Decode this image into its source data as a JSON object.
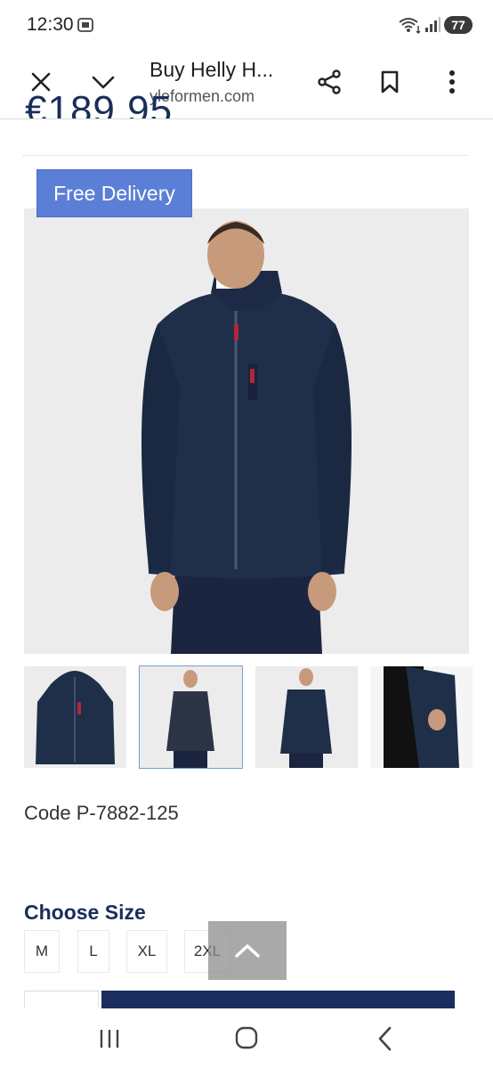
{
  "status_bar": {
    "time": "12:30",
    "battery": "77"
  },
  "browser": {
    "title": "Buy Helly H...",
    "url": "yleformen.com"
  },
  "product": {
    "price": "€189.95",
    "badge": "Free Delivery",
    "code": "Code P-7882-125",
    "colors": {
      "jacket": "#1f2e49",
      "accent": "#1a2d5c",
      "badge": "#5b7fd6"
    }
  },
  "sizes": {
    "heading": "Choose Size",
    "options": [
      "M",
      "L",
      "XL",
      "2XL"
    ]
  },
  "icons": {
    "close": "close-icon",
    "collapse": "chevron-down-icon",
    "share": "share-icon",
    "bookmark": "bookmark-icon",
    "menu": "more-vertical-icon",
    "scroll_top": "chevron-up-icon"
  }
}
